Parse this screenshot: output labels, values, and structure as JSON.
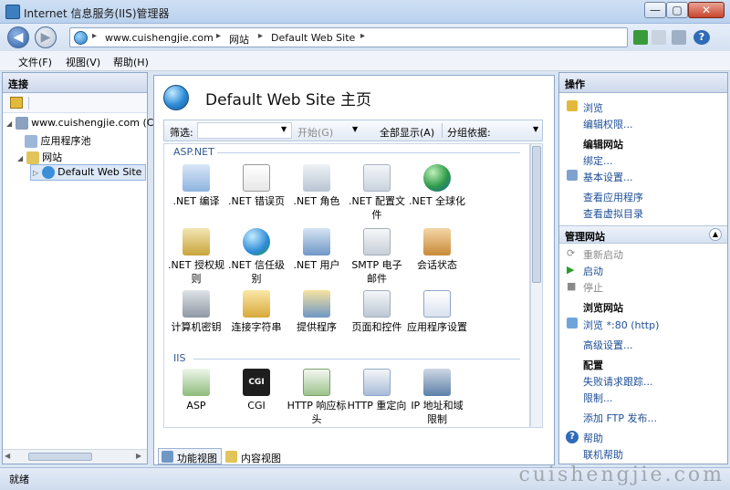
{
  "window": {
    "title": "Internet 信息服务(IIS)管理器",
    "min": "—",
    "max": "▢",
    "close": "✕"
  },
  "address": {
    "crumbs": [
      "www.cuishengjie.com",
      "网站",
      "Default Web Site"
    ],
    "sep": "▸"
  },
  "menu": [
    "文件(F)",
    "视图(V)",
    "帮助(H)"
  ],
  "connections": {
    "title": "连接",
    "tree": {
      "server": "www.cuishengjie.com (CS",
      "app_pools": "应用程序池",
      "sites": "网站",
      "site": "Default Web Site"
    }
  },
  "center": {
    "title": "Default Web Site 主页",
    "filter": {
      "label": "筛选:",
      "start": "开始(G)",
      "show_all": "全部显示(A)",
      "group_by": "分组依据:"
    },
    "groups": [
      {
        "name": "ASP.NET",
        "items": [
          ".NET 编译",
          ".NET 错误页",
          ".NET 角色",
          ".NET 配置文件",
          ".NET 全球化",
          ".NET 授权规则",
          ".NET 信任级别",
          ".NET 用户",
          "SMTP 电子邮件",
          "会话状态",
          "计算机密钥",
          "连接字符串",
          "提供程序",
          "页面和控件",
          "应用程序设置"
        ]
      },
      {
        "name": "IIS",
        "items": [
          "ASP",
          "CGI",
          "HTTP 响应标头",
          "HTTP 重定向",
          "IP 地址和域限制"
        ]
      }
    ],
    "views": {
      "features": "功能视图",
      "content": "内容视图"
    }
  },
  "actions": {
    "title": "操作",
    "browse": "浏览",
    "edit_perms": "编辑权限...",
    "edit_site": "编辑网站",
    "bindings": "绑定...",
    "basic_settings": "基本设置...",
    "view_apps": "查看应用程序",
    "view_vdirs": "查看虚拟目录",
    "manage_site": "管理网站",
    "restart": "重新启动",
    "start": "启动",
    "stop": "停止",
    "browse_site": "浏览网站",
    "browse_80": "浏览 *:80 (http)",
    "advanced": "高级设置...",
    "config": "配置",
    "failed_req": "失败请求跟踪...",
    "limits": "限制...",
    "add_ftp": "添加 FTP 发布...",
    "help": "帮助",
    "online_help": "联机帮助"
  },
  "status": "就绪",
  "watermark": "cuishengjie.com",
  "colors": {
    "accent": "#2f5a93",
    "link": "#1e4f96",
    "start_green": "#2a9d2a"
  }
}
